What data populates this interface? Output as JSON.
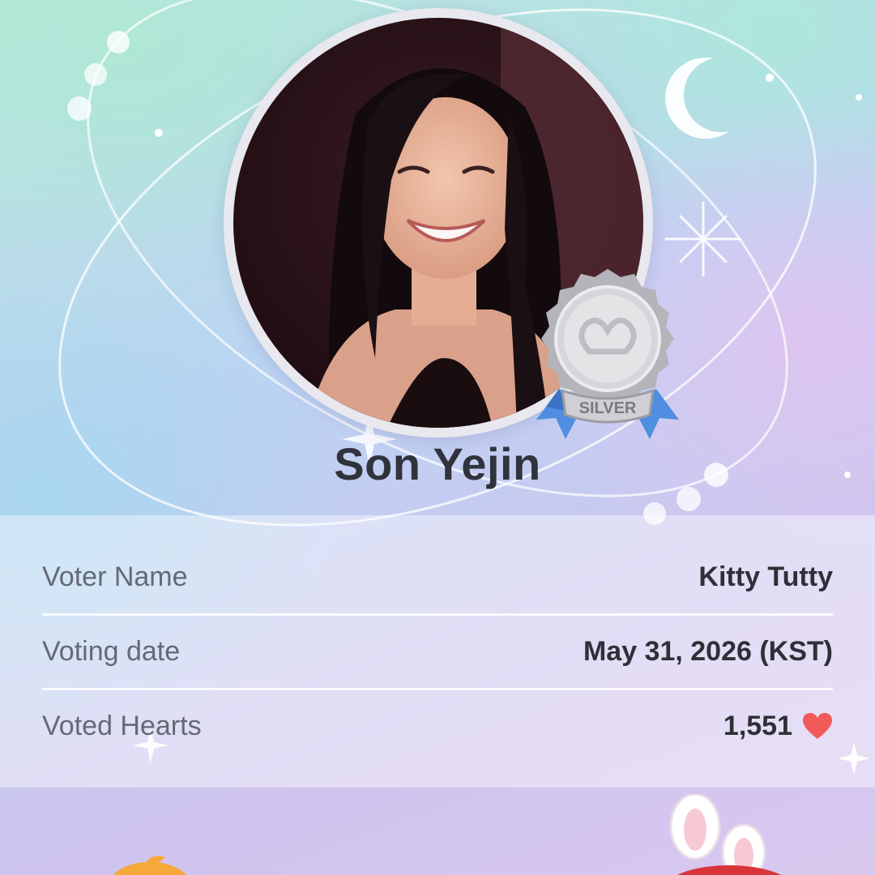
{
  "idol": {
    "name": "Son Yejin",
    "tier_badge": "SILVER"
  },
  "vote_info": {
    "rows": [
      {
        "label": "Voter Name",
        "value": "Kitty Tutty"
      },
      {
        "label": "Voting date",
        "value": "May 31, 2026 (KST)"
      },
      {
        "label": "Voted Hearts",
        "value": "1,551"
      }
    ]
  },
  "icons": {
    "heart": "heart-icon",
    "moon": "crescent-moon-icon",
    "sparkle": "sparkle-icon",
    "badge": "silver-medal-icon"
  },
  "colors": {
    "heart": "#f25a5a",
    "badge_ribbon": "#4f8ee0",
    "badge_silver": "#c8c8cc",
    "name_text": "#30333c"
  }
}
